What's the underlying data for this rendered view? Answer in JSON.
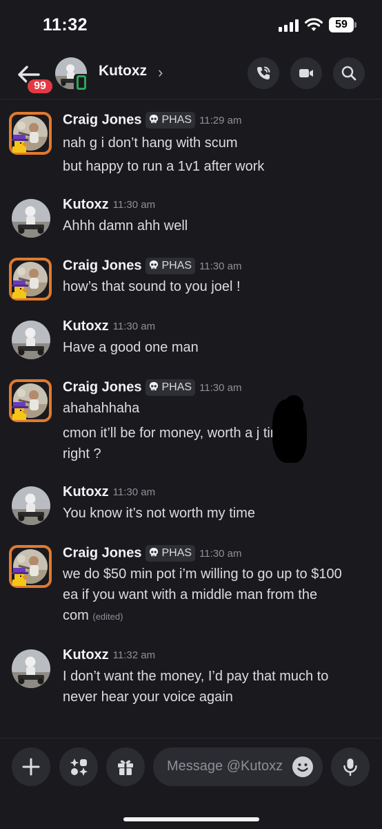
{
  "status_bar": {
    "time": "11:32",
    "battery": "59"
  },
  "header": {
    "unread_badge": "99",
    "contact_name": "Kutoxz",
    "chevron": "›",
    "icons": [
      "back-arrow-icon",
      "phone-call-icon",
      "video-camera-icon",
      "search-icon"
    ]
  },
  "messages": [
    {
      "author": "Craig Jones",
      "tag": "PHAS",
      "time": "11:29 am",
      "lines": [
        "nah g i don’t hang with scum",
        "but happy to run a 1v1 after work"
      ]
    },
    {
      "author": "Kutoxz",
      "time": "11:30 am",
      "lines": [
        "Ahhh damn ahh well"
      ]
    },
    {
      "author": "Craig Jones",
      "tag": "PHAS",
      "time": "11:30 am",
      "lines": [
        "how’s that sound to you joel !"
      ]
    },
    {
      "author": "Kutoxz",
      "time": "11:30 am",
      "lines": [
        "Have a good one man"
      ]
    },
    {
      "author": "Craig Jones",
      "tag": "PHAS",
      "time": "11:30 am",
      "lines": [
        "ahahahhaha",
        "cmon it’ll be for money, worth a j      time",
        "right ?"
      ]
    },
    {
      "author": "Kutoxz",
      "time": "11:30 am",
      "lines": [
        "You know it’s not worth my time"
      ]
    },
    {
      "author": "Craig Jones",
      "tag": "PHAS",
      "time": "11:30 am",
      "lines": [
        "we do $50 min pot i’m willing to go up to $100",
        "ea if you want with a middle man from the",
        "com"
      ],
      "edited": "(edited)"
    },
    {
      "author": "Kutoxz",
      "time": "11:32 am",
      "lines": [
        "I don’t want the money, I’d pay that much to",
        "never hear your voice again"
      ]
    }
  ],
  "composer": {
    "placeholder": "Message @Kutoxz",
    "icons": [
      "plus-icon",
      "apps-icon",
      "gift-icon",
      "emoji-icon",
      "microphone-icon"
    ]
  },
  "colors": {
    "background": "#1a1a1e",
    "badge": "#e23a44",
    "online_mobile": "#2fa55b",
    "avatar_frame": "#e27a2e"
  }
}
